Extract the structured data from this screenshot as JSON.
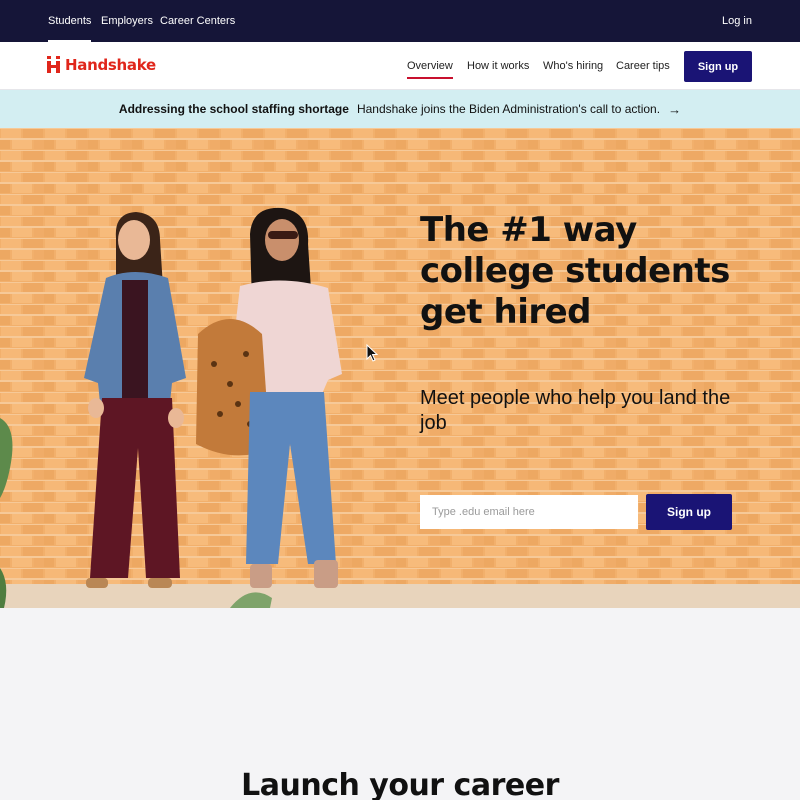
{
  "top_bar": {
    "tabs": [
      {
        "label": "Students",
        "active": true
      },
      {
        "label": "Employers",
        "active": false
      },
      {
        "label": "Career Centers",
        "active": false
      }
    ],
    "login_label": "Log in"
  },
  "nav": {
    "logo_text": "Handshake",
    "links": [
      {
        "label": "Overview",
        "active": true
      },
      {
        "label": "How it works",
        "active": false
      },
      {
        "label": "Who's hiring",
        "active": false
      },
      {
        "label": "Career tips",
        "active": false
      }
    ],
    "signup_label": "Sign up"
  },
  "banner": {
    "headline": "Addressing the school staffing shortage",
    "text": "Handshake joins the Biden Administration's call to action.",
    "icon": "arrow-right-icon"
  },
  "hero": {
    "title": "The #1 way college students get hired",
    "subtitle": "Meet people who help you land the job",
    "email_placeholder": "Type .edu email here",
    "signup_label": "Sign up"
  },
  "section": {
    "title": "Launch your career"
  },
  "colors": {
    "top_bar_bg": "#151538",
    "brand_red": "#e0261b",
    "button_bg": "#1a1475",
    "banner_bg": "#d3eef2",
    "hero_wall": "#f2b06c",
    "page_bg": "#f4f4f6"
  }
}
